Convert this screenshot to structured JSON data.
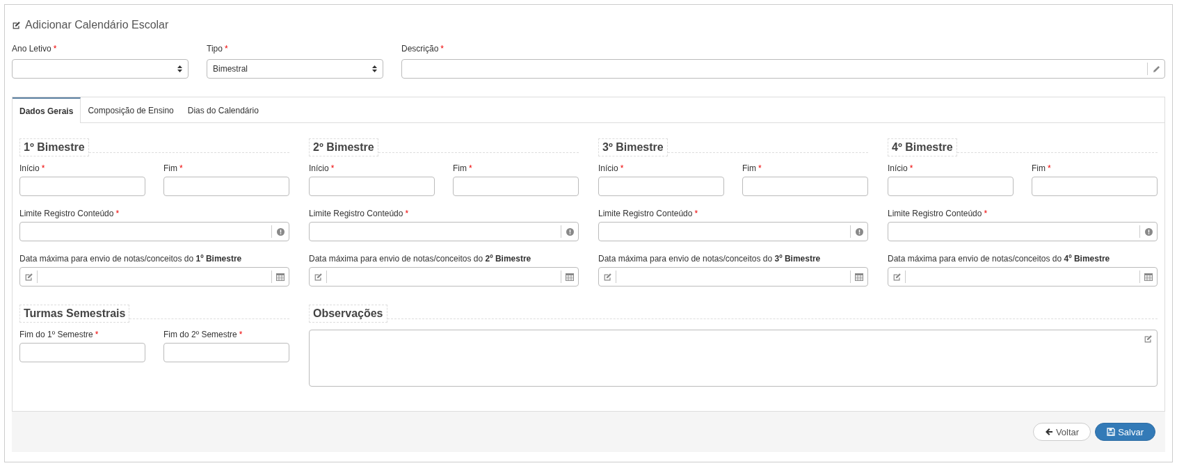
{
  "header": {
    "title": "Adicionar Calendário Escolar"
  },
  "required_mark": "*",
  "top_fields": [
    {
      "kind": "select",
      "label": "Ano Letivo",
      "required": true
    },
    {
      "kind": "select",
      "label": "Tipo",
      "required": true,
      "value": "Bimestral"
    },
    {
      "kind": "text",
      "label": "Descrição",
      "required": true
    }
  ],
  "tabs": [
    {
      "label": "Dados Gerais",
      "selected": true
    },
    {
      "label": "Composição de Ensino",
      "selected": false
    },
    {
      "label": "Dias do Calendário",
      "selected": false
    }
  ],
  "bimestres": [
    {
      "title": "1º Bimestre",
      "fields": [
        {
          "kind": "short",
          "label": "Início",
          "required": true
        },
        {
          "kind": "short",
          "label": "Fim",
          "required": true
        },
        {
          "kind": "info",
          "label": "Limite Registro Conteúdo",
          "required": true
        },
        {
          "kind": "calendar",
          "label": "Data máxima para envio de notas/conceitos do **1º Bimestre**",
          "required": false
        }
      ]
    },
    {
      "title": "2º Bimestre",
      "fields": [
        {
          "kind": "short",
          "label": "Início",
          "required": true
        },
        {
          "kind": "short",
          "label": "Fim",
          "required": true
        },
        {
          "kind": "info",
          "label": "Limite Registro Conteúdo",
          "required": true
        },
        {
          "kind": "calendar",
          "label": "Data máxima para envio de notas/conceitos do **2º Bimestre**",
          "required": false
        }
      ]
    },
    {
      "title": "3º Bimestre",
      "fields": [
        {
          "kind": "short",
          "label": "Início",
          "required": true
        },
        {
          "kind": "short",
          "label": "Fim",
          "required": true
        },
        {
          "kind": "info",
          "label": "Limite Registro Conteúdo",
          "required": true
        },
        {
          "kind": "calendar",
          "label": "Data máxima para envio de notas/conceitos do **3º Bimestre**",
          "required": false
        }
      ]
    },
    {
      "title": "4º Bimestre",
      "fields": [
        {
          "kind": "short",
          "label": "Início",
          "required": true
        },
        {
          "kind": "short",
          "label": "Fim",
          "required": true
        },
        {
          "kind": "info",
          "label": "Limite Registro Conteúdo",
          "required": true
        },
        {
          "kind": "calendar",
          "label": "Data máxima para envio de notas/conceitos do **4º Bimestre**",
          "required": false
        }
      ]
    }
  ],
  "semestrais": {
    "title": "Turmas Semestrais",
    "fields": [
      {
        "kind": "short",
        "label": "Fim do 1º Semestre",
        "required": true
      },
      {
        "kind": "short",
        "label": "Fim do 2º Semestre",
        "required": true
      }
    ]
  },
  "observacoes": {
    "title": "Observações"
  },
  "buttons": [
    {
      "kind": "back",
      "label": "Voltar"
    },
    {
      "kind": "save",
      "label": "Salvar"
    }
  ]
}
